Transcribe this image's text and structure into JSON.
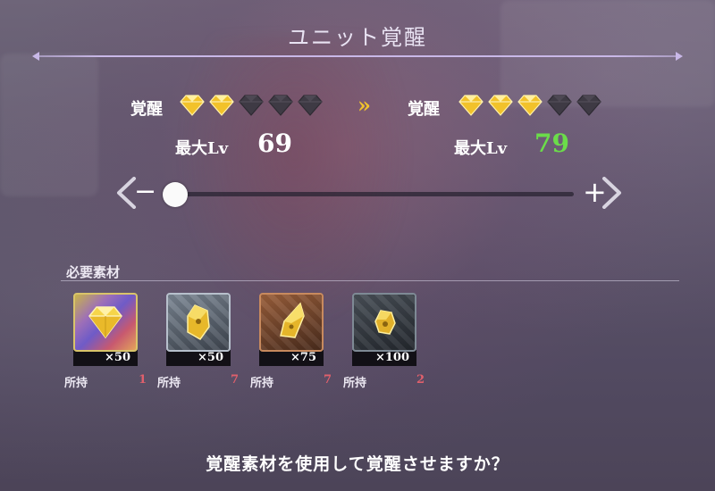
{
  "header": {
    "title": "ユニット覚醒"
  },
  "current": {
    "awakening_label": "覚醒",
    "stars_filled": 2,
    "stars_total": 5,
    "max_lv_label": "最大Lv",
    "max_lv": "69"
  },
  "next": {
    "awakening_label": "覚醒",
    "stars_filled": 3,
    "stars_total": 5,
    "max_lv_label": "最大Lv",
    "max_lv": "79"
  },
  "transition_icon": "»",
  "slider": {
    "minus_label": "−",
    "plus_label": "+",
    "level": 0
  },
  "materials": {
    "section_label": "必要素材",
    "items": [
      {
        "icon": "rainbow-diamond-icon",
        "quantity": "×50",
        "owned_label": "所持",
        "owned": "1"
      },
      {
        "icon": "gold-shard-icon",
        "quantity": "×50",
        "owned_label": "所持",
        "owned": "7"
      },
      {
        "icon": "gold-crystal-icon",
        "quantity": "×75",
        "owned_label": "所持",
        "owned": "7"
      },
      {
        "icon": "gold-nugget-icon",
        "quantity": "×100",
        "owned_label": "所持",
        "owned": "2"
      }
    ]
  },
  "confirm": {
    "question": "覚醒素材を使用して覚醒させますか？"
  },
  "colors": {
    "gem_gold": "#f2c22a",
    "gem_empty": "#3e3a44",
    "next_lv": "#6bdc4a",
    "owned_count": "#e0606c",
    "accent_line": "#c9b8e8"
  }
}
